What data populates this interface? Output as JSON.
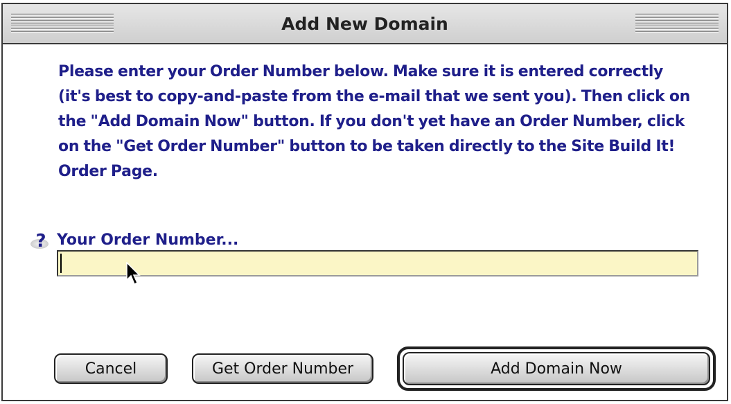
{
  "window": {
    "title": "Add New Domain"
  },
  "instructions": "Please enter your Order Number below.  Make sure it is entered correctly (it's best to copy-and-paste from the e-mail that we sent you). Then click on the \"Add Domain Now\" button. If you don't yet have an Order Number, click on the \"Get Order Number\" button to be taken directly to the Site Build It! Order Page.",
  "order_field": {
    "label": "Your Order Number...",
    "value": "",
    "help_icon": "question-mark-icon"
  },
  "buttons": {
    "cancel": "Cancel",
    "get_order_number": "Get Order Number",
    "add_domain_now": "Add Domain Now"
  },
  "colors": {
    "text": "#1f1f8a",
    "input_bg": "#fbf6c6"
  }
}
